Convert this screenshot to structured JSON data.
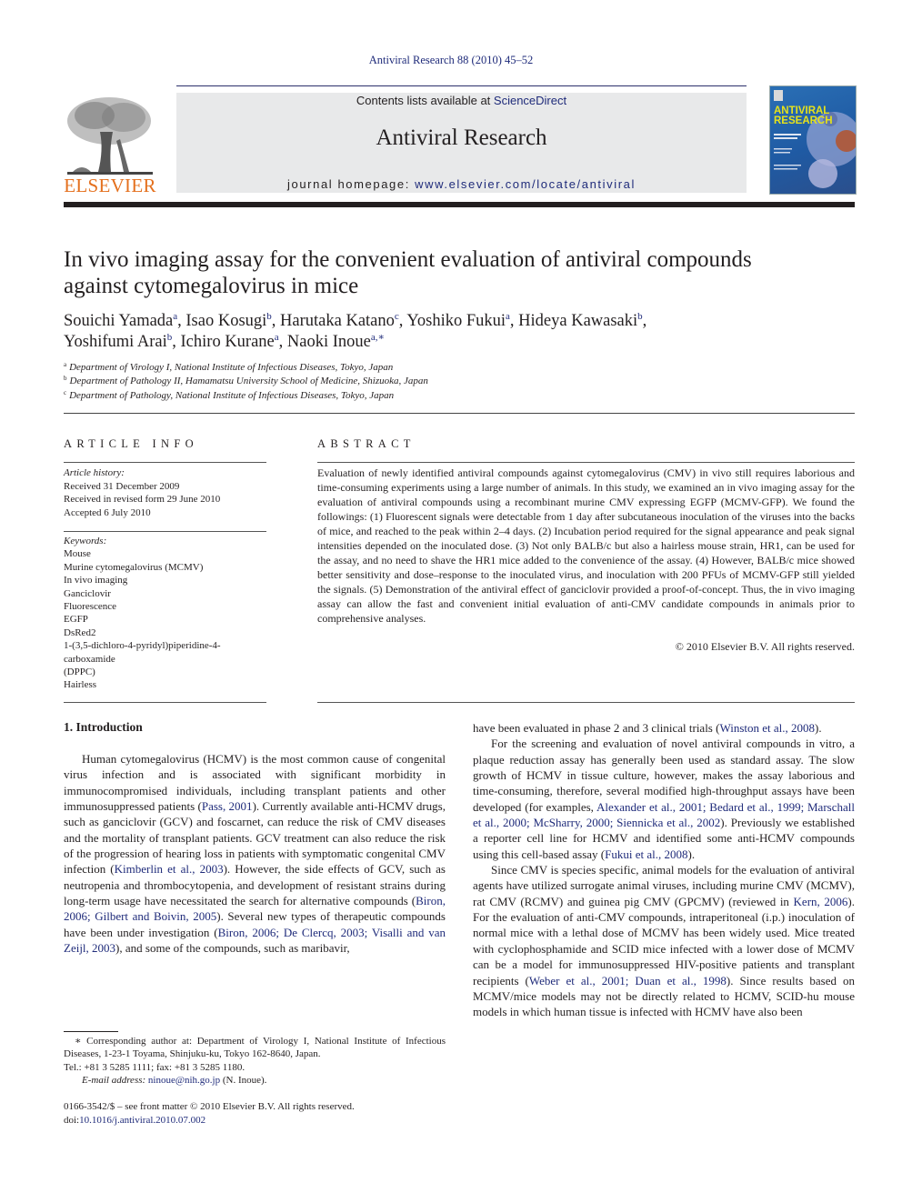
{
  "header": {
    "citation": "Antiviral Research 88 (2010) 45–52",
    "contents_prefix": "Contents lists available at ",
    "contents_link": "ScienceDirect",
    "journal_name": "Antiviral Research",
    "homepage_prefix": "journal homepage: ",
    "homepage_url": "www.elsevier.com/locate/antiviral",
    "publisher_logo_text": "ELSEVIER",
    "cover_title_line1": "ANTIVIRAL",
    "cover_title_line2": "RESEARCH"
  },
  "article": {
    "title_line1": "In vivo imaging assay for the convenient evaluation of antiviral compounds",
    "title_line2": "against cytomegalovirus in mice",
    "authors": [
      {
        "name": "Souichi Yamada",
        "sup": "a"
      },
      {
        "name": "Isao Kosugi",
        "sup": "b"
      },
      {
        "name": "Harutaka Katano",
        "sup": "c"
      },
      {
        "name": "Yoshiko Fukui",
        "sup": "a"
      },
      {
        "name": "Hideya Kawasaki",
        "sup": "b"
      },
      {
        "name": "Yoshifumi Arai",
        "sup": "b"
      },
      {
        "name": "Ichiro Kurane",
        "sup": "a"
      },
      {
        "name": "Naoki Inoue",
        "sup": "a,∗"
      }
    ],
    "affiliations": [
      {
        "mark": "a",
        "text": "Department of Virology I, National Institute of Infectious Diseases, Tokyo, Japan"
      },
      {
        "mark": "b",
        "text": "Department of Pathology II, Hamamatsu University School of Medicine, Shizuoka, Japan"
      },
      {
        "mark": "c",
        "text": "Department of Pathology, National Institute of Infectious Diseases, Tokyo, Japan"
      }
    ]
  },
  "article_info": {
    "heading": "ARTICLE INFO",
    "history_label": "Article history:",
    "history": [
      "Received 31 December 2009",
      "Received in revised form 29 June 2010",
      "Accepted 6 July 2010"
    ],
    "keywords_label": "Keywords:",
    "keywords": [
      "Mouse",
      "Murine cytomegalovirus (MCMV)",
      "In vivo imaging",
      "Ganciclovir",
      "Fluorescence",
      "EGFP",
      "DsRed2",
      "1-(3,5-dichloro-4-pyridyl)piperidine-4-",
      "carboxamide",
      "(DPPC)",
      "Hairless"
    ]
  },
  "abstract": {
    "heading": "ABSTRACT",
    "text": "Evaluation of newly identified antiviral compounds against cytomegalovirus (CMV) in vivo still requires laborious and time-consuming experiments using a large number of animals. In this study, we examined an in vivo imaging assay for the evaluation of antiviral compounds using a recombinant murine CMV expressing EGFP (MCMV-GFP). We found the followings: (1) Fluorescent signals were detectable from 1 day after subcutaneous inoculation of the viruses into the backs of mice, and reached to the peak within 2–4 days. (2) Incubation period required for the signal appearance and peak signal intensities depended on the inoculated dose. (3) Not only BALB/c but also a hairless mouse strain, HR1, can be used for the assay, and no need to shave the HR1 mice added to the convenience of the assay. (4) However, BALB/c mice showed better sensitivity and dose–response to the inoculated virus, and inoculation with 200 PFUs of MCMV-GFP still yielded the signals. (5) Demonstration of the antiviral effect of ganciclovir provided a proof-of-concept. Thus, the in vivo imaging assay can allow the fast and convenient initial evaluation of anti-CMV candidate compounds in animals prior to comprehensive analyses.",
    "copyright": "© 2010 Elsevier B.V. All rights reserved."
  },
  "body": {
    "section_heading": "1.  Introduction",
    "left_para": [
      {
        "t": "Human cytomegalovirus (HCMV) is the most common cause of congenital virus infection and is associated with significant morbidity in immunocompromised individuals, including transplant patients and other immunosuppressed patients ("
      },
      {
        "ref": "Pass, 2001"
      },
      {
        "t": "). Currently available anti-HCMV drugs, such as ganciclovir (GCV) and foscarnet, can reduce the risk of CMV diseases and the mortality of transplant patients. GCV treatment can also reduce the risk of the progression of hearing loss in patients with symptomatic congenital CMV infection ("
      },
      {
        "ref": "Kimberlin et al., 2003"
      },
      {
        "t": "). However, the side effects of GCV, such as neutropenia and thrombocytopenia, and development of resistant strains during long-term usage have necessitated the search for alternative compounds ("
      },
      {
        "ref": "Biron, 2006; Gilbert and Boivin, 2005"
      },
      {
        "t": "). Several new types of therapeutic compounds have been under investigation ("
      },
      {
        "ref": "Biron, 2006; De Clercq, 2003; Visalli and van Zeijl, 2003"
      },
      {
        "t": "), and some of the compounds, such as maribavir,"
      }
    ],
    "right_para1": [
      {
        "t": "have been evaluated in phase 2 and 3 clinical trials ("
      },
      {
        "ref": "Winston et al., 2008"
      },
      {
        "t": ")."
      }
    ],
    "right_para2": [
      {
        "t": "For the screening and evaluation of novel antiviral compounds in vitro, a plaque reduction assay has generally been used as standard assay. The slow growth of HCMV in tissue culture, however, makes the assay laborious and time-consuming, therefore, several modified high-throughput assays have been developed (for examples, "
      },
      {
        "ref": "Alexander et al., 2001; Bedard et al., 1999; Marschall et al., 2000; McSharry, 2000; Siennicka et al., 2002"
      },
      {
        "t": "). Previously we established a reporter cell line for HCMV and identified some anti-HCMV compounds using this cell-based assay ("
      },
      {
        "ref": "Fukui et al., 2008"
      },
      {
        "t": ")."
      }
    ],
    "right_para3": [
      {
        "t": "Since CMV is species specific, animal models for the evaluation of antiviral agents have utilized surrogate animal viruses, including murine CMV (MCMV), rat CMV (RCMV) and guinea pig CMV (GPCMV) (reviewed in "
      },
      {
        "ref": "Kern, 2006"
      },
      {
        "t": "). For the evaluation of anti-CMV compounds, intraperitoneal (i.p.) inoculation of normal mice with a lethal dose of MCMV has been widely used. Mice treated with cyclophosphamide and SCID mice infected with a lower dose of MCMV can be a model for immunosuppressed HIV-positive patients and transplant recipients ("
      },
      {
        "ref": "Weber et al., 2001; Duan et al., 1998"
      },
      {
        "t": "). Since results based on MCMV/mice models may not be directly related to HCMV, SCID-hu mouse models in which human tissue is infected with HCMV have also been"
      }
    ]
  },
  "footnote": {
    "star_text": "∗ Corresponding author at: Department of Virology I, National Institute of Infectious Diseases, 1-23-1 Toyama, Shinjuku-ku, Tokyo 162-8640, Japan.",
    "tel_text": "Tel.: +81 3 5285 1111; fax: +81 3 5285 1180.",
    "email_label": "E-mail address: ",
    "email": "ninoue@nih.go.jp",
    "email_suffix": " (N. Inoue).",
    "frontmatter": "0166-3542/$ – see front matter © 2010 Elsevier B.V. All rights reserved.",
    "doi_prefix": "doi:",
    "doi": "10.1016/j.antiviral.2010.07.002"
  },
  "colors": {
    "link": "#1f2b7a",
    "elsevier_orange": "#e4701e",
    "header_box": "#e8e9ea",
    "cover_blue": "#1f5aa3",
    "cover_yellow": "#e6e21b"
  }
}
